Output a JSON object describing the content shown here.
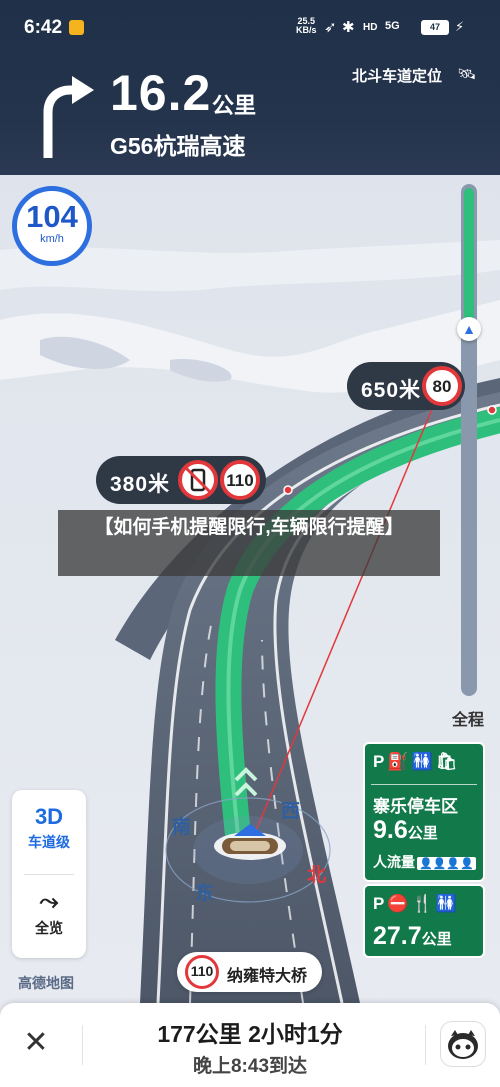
{
  "status_bar": {
    "time": "6:42",
    "net_speed": "25.5",
    "net_unit": "KB/s",
    "hd": "HD",
    "signal": "5G",
    "battery": "47"
  },
  "guidance": {
    "distance": "16.2",
    "distance_unit": "公里",
    "road_name": "G56杭瑞高速",
    "lane_mode": "北斗车道定位",
    "turn_icon": "turn-left-arrow-icon"
  },
  "speed": {
    "value": "104",
    "unit": "km/h"
  },
  "cameras": [
    {
      "distance": "650米",
      "limit": "80"
    },
    {
      "distance": "380米",
      "limit": "110",
      "extra_icon": "no-phone-icon"
    }
  ],
  "overlay_title": "【如何手机提醒限行,车辆限行提醒】",
  "route_progress": {
    "traveled_fraction": 0.28
  },
  "overview_label": "全程",
  "left_panel": {
    "lane_level_big": "3D",
    "lane_level_label": "车道级",
    "overview_label": "全览"
  },
  "brand": "高德地图",
  "service_areas": [
    {
      "icons": "P 加油 卫生间 商店",
      "name": "寨乐停车区",
      "distance": "9.6",
      "unit": "公里",
      "flow_label": "人流量"
    },
    {
      "icons": "P 禁止加油 餐饮 卫生间",
      "distance": "27.7",
      "unit": "公里"
    }
  ],
  "next_road": {
    "limit": "110",
    "name": "纳雍特大桥"
  },
  "compass": {
    "south": "南",
    "west": "西",
    "east": "东",
    "north": "北"
  },
  "bottom": {
    "summary": "177公里  2小时1分",
    "eta": "晚上8:43到达"
  },
  "colors": {
    "header_bg": "#203048",
    "route_green": "#2fbf7d",
    "service_green": "#12794a",
    "limit_red": "#e2383b",
    "accent_blue": "#2e6fe0"
  }
}
